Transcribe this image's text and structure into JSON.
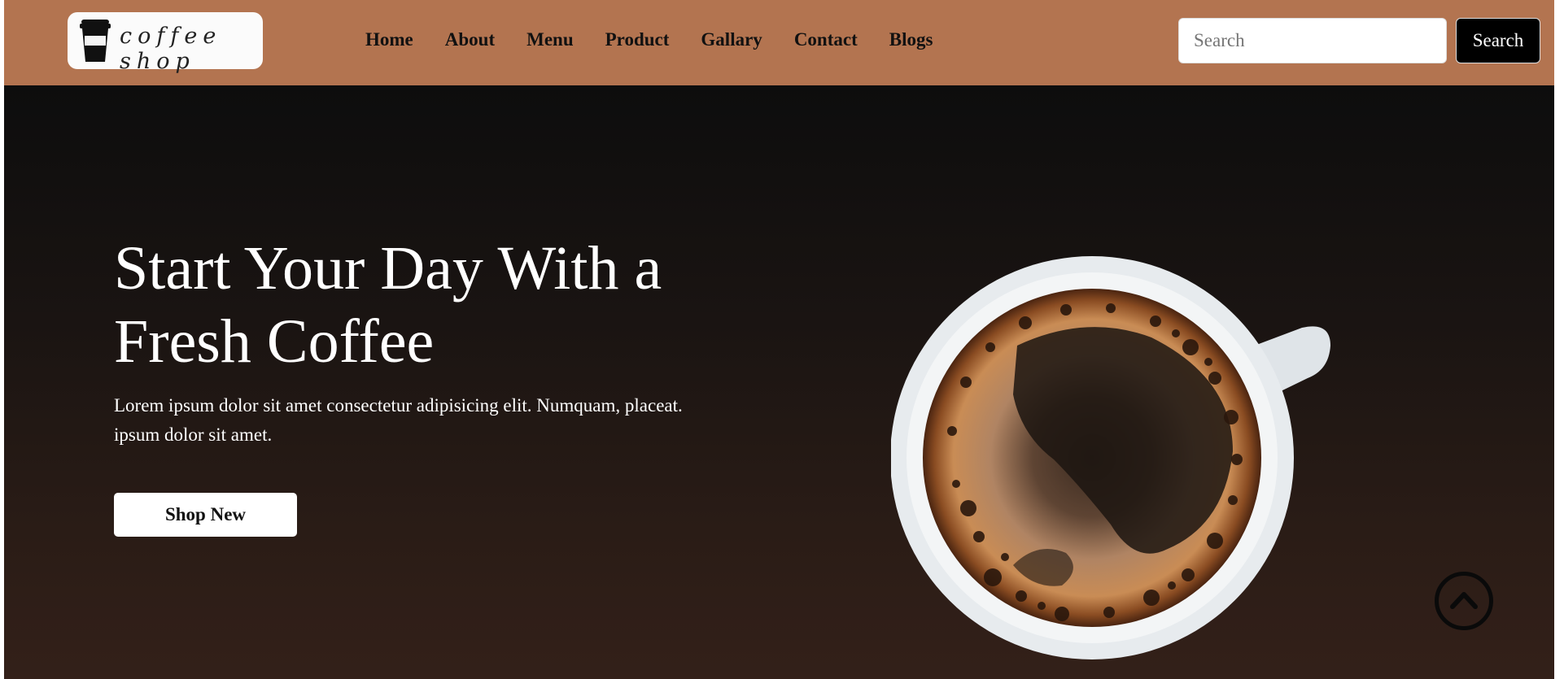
{
  "brand": {
    "logo_text": "coffee shop",
    "logo_icon": "coffee-cup-icon"
  },
  "nav": {
    "links": [
      "Home",
      "About",
      "Menu",
      "Product",
      "Gallary",
      "Contact",
      "Blogs"
    ]
  },
  "search": {
    "placeholder": "Search",
    "value": "",
    "button_label": "Search"
  },
  "hero": {
    "title": "Start Your Day With a Fresh Coffee",
    "text": "Lorem ipsum dolor sit amet consectetur adipisicing elit. Numquam, placeat. ipsum dolor sit amet.",
    "button_label": "Shop New",
    "image_icon": "coffee-cup-top-view",
    "scroll_icon": "chevron-up-circle-icon"
  },
  "colors": {
    "navbar": "#b37450",
    "hero_top": "#0d0d0d",
    "hero_bottom": "#332019",
    "button_dark": "#000000",
    "button_light": "#ffffff"
  }
}
